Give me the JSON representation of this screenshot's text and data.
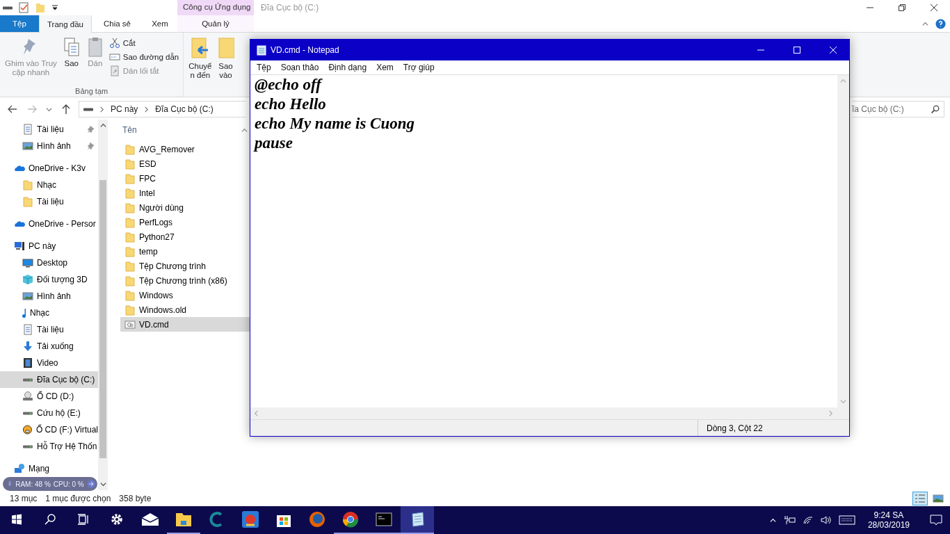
{
  "explorer": {
    "context_tab": "Công cụ Ứng dụng",
    "title": "Đĩa Cục bộ (C:)",
    "ribbon_tabs": [
      {
        "label": "Tệp",
        "kind": "file",
        "selected": false
      },
      {
        "label": "Trang đầu",
        "kind": "tab",
        "selected": true
      },
      {
        "label": "Chia sẻ",
        "kind": "tab",
        "selected": false
      },
      {
        "label": "Xem",
        "kind": "tab",
        "selected": false
      },
      {
        "label": "Quản lý",
        "kind": "context",
        "selected": false
      }
    ],
    "clipboard": {
      "label": "Bảng tạm",
      "big": [
        {
          "kind": "pin",
          "lines": [
            "Ghim vào Truy",
            "cập nhanh"
          ],
          "disabled": true
        },
        {
          "kind": "copy",
          "lines": [
            "Sao"
          ],
          "disabled": false
        },
        {
          "kind": "paste",
          "lines": [
            "Dán"
          ],
          "disabled": true
        }
      ],
      "small": [
        {
          "kind": "cut",
          "label": "Cắt",
          "disabled": false
        },
        {
          "kind": "path",
          "label": "Sao đường dẫn",
          "disabled": false
        },
        {
          "kind": "shortcut",
          "label": "Dán lối tắt",
          "disabled": true
        }
      ]
    },
    "organize": [
      {
        "kind": "move",
        "lines": [
          "Chuyể",
          "n đến"
        ]
      },
      {
        "kind": "copyto",
        "lines": [
          "Sao",
          "vào"
        ]
      }
    ],
    "address": [
      "PC này",
      "Đĩa Cục bộ (C:)"
    ],
    "search": {
      "placeholder": "ĩa Cục bộ (C:)"
    },
    "nav": [
      {
        "label": "Tài liệu",
        "kind": "docs",
        "pinned": true,
        "selected": false
      },
      {
        "label": "Hình ảnh",
        "kind": "pictures",
        "pinned": true,
        "selected": false
      },
      {
        "label": "OneDrive - K3v",
        "kind": "onedrive",
        "pinned": false,
        "selected": false,
        "children": [
          {
            "label": "Nhạc",
            "kind": "folder",
            "pinned": false,
            "selected": false
          },
          {
            "label": "Tài liệu",
            "kind": "folder",
            "pinned": false,
            "selected": false
          }
        ]
      },
      {
        "label": "OneDrive - Persor",
        "kind": "onedrive",
        "pinned": false,
        "selected": false
      },
      {
        "label": "PC này",
        "kind": "pc",
        "pinned": false,
        "selected": false,
        "children": [
          {
            "label": "Desktop",
            "kind": "desktop",
            "pinned": false,
            "selected": false
          },
          {
            "label": "Đối tượng 3D",
            "kind": "cube",
            "pinned": false,
            "selected": false
          },
          {
            "label": "Hình ảnh",
            "kind": "pictures",
            "pinned": false,
            "selected": false
          },
          {
            "label": "Nhạc",
            "kind": "music",
            "pinned": false,
            "selected": false
          },
          {
            "label": "Tài liệu",
            "kind": "docs",
            "pinned": false,
            "selected": false
          },
          {
            "label": "Tải xuống",
            "kind": "download",
            "pinned": false,
            "selected": false
          },
          {
            "label": "Video",
            "kind": "video",
            "pinned": false,
            "selected": false
          },
          {
            "label": "Đĩa Cục bộ (C:)",
            "kind": "drive",
            "pinned": false,
            "selected": true
          },
          {
            "label": "Ổ CD (D:)",
            "kind": "cd",
            "pinned": false,
            "selected": false
          },
          {
            "label": "Cứu hộ (E:)",
            "kind": "drive",
            "pinned": false,
            "selected": false
          },
          {
            "label": "Ổ CD (F:) Virtual",
            "kind": "virtual",
            "pinned": false,
            "selected": false
          },
          {
            "label": "Hỗ Trợ Hệ Thốn",
            "kind": "drive",
            "pinned": false,
            "selected": false
          }
        ]
      },
      {
        "label": "Mạng",
        "kind": "network",
        "pinned": false,
        "selected": false
      }
    ],
    "column": "Tên",
    "files": [
      {
        "name": "AVG_Remover",
        "kind": "folder",
        "selected": false
      },
      {
        "name": "ESD",
        "kind": "folder",
        "selected": false
      },
      {
        "name": "FPC",
        "kind": "folder",
        "selected": false
      },
      {
        "name": "Intel",
        "kind": "folder",
        "selected": false
      },
      {
        "name": "Người dùng",
        "kind": "folder",
        "selected": false
      },
      {
        "name": "PerfLogs",
        "kind": "folder",
        "selected": false
      },
      {
        "name": "Python27",
        "kind": "folder",
        "selected": false
      },
      {
        "name": "temp",
        "kind": "folder",
        "selected": false
      },
      {
        "name": "Tệp Chương trình",
        "kind": "folder",
        "selected": false
      },
      {
        "name": "Tệp Chương trình (x86)",
        "kind": "folder",
        "selected": false
      },
      {
        "name": "Windows",
        "kind": "folder",
        "selected": false
      },
      {
        "name": "Windows.old",
        "kind": "folder",
        "selected": false
      },
      {
        "name": "VD.cmd",
        "kind": "cmd",
        "selected": true
      }
    ],
    "status": [
      "13 mục",
      "1 mục được chọn",
      "358 byte"
    ],
    "views": [
      {
        "kind": "details",
        "selected": true
      },
      {
        "kind": "large",
        "selected": false
      }
    ]
  },
  "monitor": {
    "ram": "RAM: 48 %",
    "cpu": "CPU: 0 %"
  },
  "notepad": {
    "title": "VD.cmd - Notepad",
    "menu": [
      "Tệp",
      "Soạn thảo",
      "Định dạng",
      "Xem",
      "Trợ giúp"
    ],
    "lines": [
      "@echo off",
      "echo Hello",
      "echo My name is Cuong",
      "pause"
    ],
    "position": "Dòng 3, Cột 22"
  },
  "taskbar": {
    "apps": [
      {
        "kind": "start",
        "open": false,
        "active": false
      },
      {
        "kind": "search",
        "open": false,
        "active": false
      },
      {
        "kind": "taskview",
        "open": false,
        "active": false
      },
      {
        "kind": "settings",
        "open": false,
        "active": false
      },
      {
        "kind": "mail",
        "open": false,
        "active": false
      },
      {
        "kind": "explorer",
        "open": true,
        "active": false
      },
      {
        "kind": "cleaner",
        "open": false,
        "active": false
      },
      {
        "kind": "game",
        "open": false,
        "active": false
      },
      {
        "kind": "store",
        "open": false,
        "active": false
      },
      {
        "kind": "firefox",
        "open": false,
        "active": false
      },
      {
        "kind": "chrome",
        "open": true,
        "active": false
      },
      {
        "kind": "terminal",
        "open": true,
        "active": false
      },
      {
        "kind": "notepad",
        "open": true,
        "active": true
      }
    ],
    "time": "9:24 SA",
    "date": "28/03/2019"
  }
}
